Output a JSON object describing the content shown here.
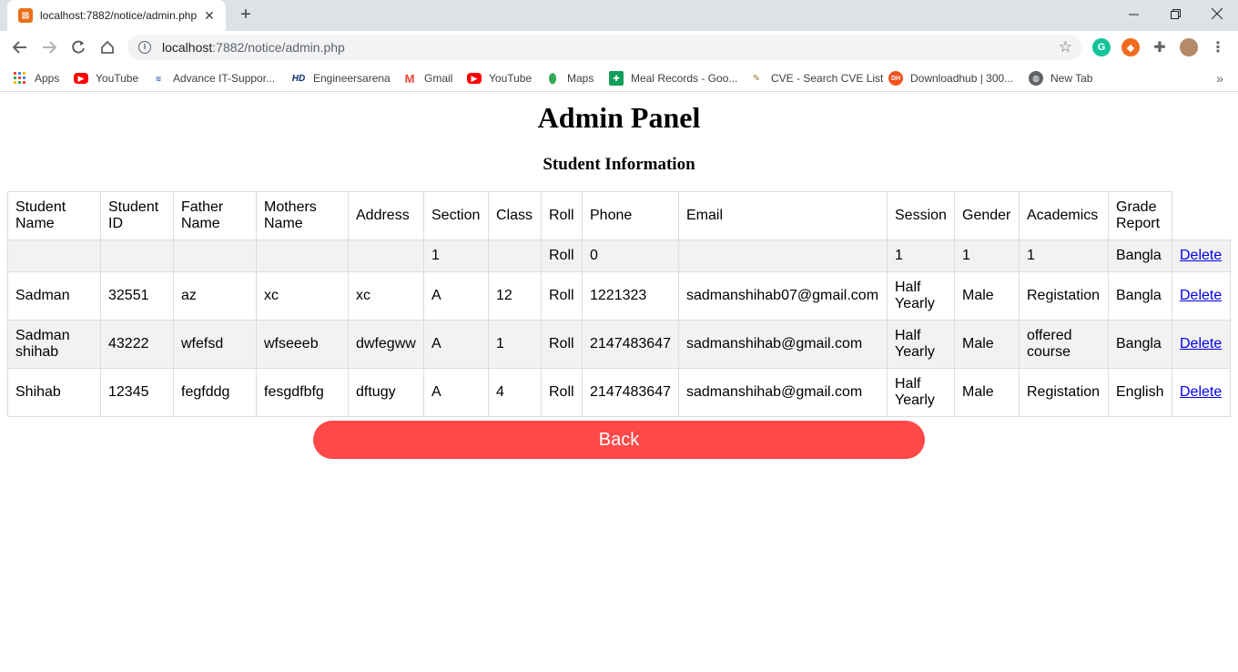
{
  "browser": {
    "tab_title": "localhost:7882/notice/admin.php",
    "url_host": "localhost",
    "url_rest": ":7882/notice/admin.php",
    "bookmarks": [
      {
        "label": "Apps",
        "icon": "apps-grid-icon"
      },
      {
        "label": "YouTube",
        "icon": "youtube-icon"
      },
      {
        "label": "Advance IT-Suppor...",
        "icon": "advance-it-icon"
      },
      {
        "label": "Engineersarena",
        "icon": "hd-icon"
      },
      {
        "label": "Gmail",
        "icon": "gmail-icon"
      },
      {
        "label": "YouTube",
        "icon": "youtube-icon"
      },
      {
        "label": "Maps",
        "icon": "maps-icon"
      },
      {
        "label": "Meal Records - Goo...",
        "icon": "sheets-icon"
      },
      {
        "label": "CVE - Search CVE List",
        "icon": "cve-icon"
      },
      {
        "label": "Downloadhub | 300...",
        "icon": "downloadhub-icon"
      },
      {
        "label": "New Tab",
        "icon": "globe-icon"
      }
    ]
  },
  "page": {
    "title": "Admin Panel",
    "subtitle": "Student Information",
    "back_label": "Back"
  },
  "table": {
    "headers": [
      "Student Name",
      "Student ID",
      "Father Name",
      "Mothers Name",
      "Address",
      "Section",
      "Class",
      "Roll",
      "Phone",
      "Email",
      "Session",
      "Gender",
      "Academics",
      "Grade Report"
    ],
    "rows": [
      [
        "",
        "",
        "",
        "",
        "",
        "1",
        "",
        "Roll",
        "0",
        "",
        "1",
        "1",
        "1",
        "Bangla",
        "Delete"
      ],
      [
        "Sadman",
        "32551",
        "az",
        "xc",
        "xc",
        "A",
        "12",
        "Roll",
        "1221323",
        "sadmanshihab07@gmail.com",
        "Half Yearly",
        "Male",
        "Registation",
        "Bangla",
        "Delete"
      ],
      [
        "Sadman shihab",
        "43222",
        "wfefsd",
        "wfseeeb",
        "dwfegww",
        "A",
        "1",
        "Roll",
        "2147483647",
        "sadmanshihab@gmail.com",
        "Half Yearly",
        "Male",
        "offered course",
        "Bangla",
        "Delete"
      ],
      [
        "Shihab",
        "12345",
        "fegfddg",
        "fesgdfbfg",
        "dftugy",
        "A",
        "4",
        "Roll",
        "2147483647",
        "sadmanshihab@gmail.com",
        "Half Yearly",
        "Male",
        "Registation",
        "English",
        "Delete"
      ]
    ]
  },
  "colors": {
    "back_button": "#ff4848",
    "link": "#0000ee",
    "row_stripe": "#f2f2f2",
    "border": "#dddddd"
  }
}
